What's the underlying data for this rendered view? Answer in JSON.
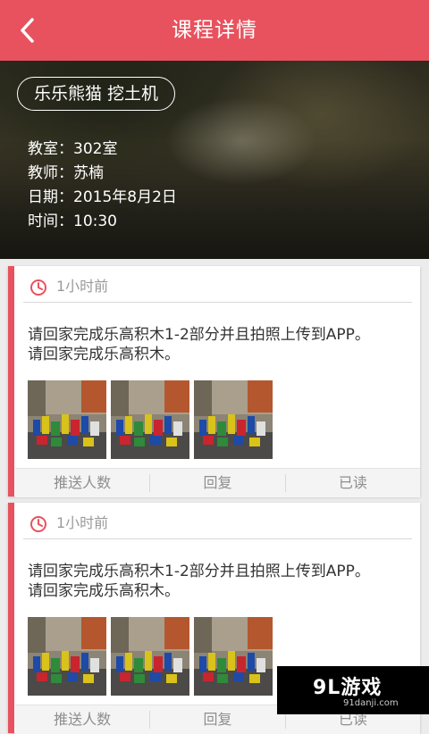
{
  "header": {
    "title": "课程详情"
  },
  "course": {
    "tag": "乐乐熊猫  挖土机",
    "classroom": "教室：302室",
    "teacher": "教师：苏楠",
    "date": "日期：2015年8月2日",
    "time": "时间：10:30"
  },
  "posts": [
    {
      "time": "1小时前",
      "message_line1": "请回家完成乐高积木1-2部分并且拍照上传到APP。",
      "message_line2": "请回家完成乐高积木。",
      "actions": {
        "push_count": "推送人数",
        "reply": "回复",
        "read": "已读"
      }
    },
    {
      "time": "1小时前",
      "message_line1": "请回家完成乐高积木1-2部分并且拍照上传到APP。",
      "message_line2": "请回家完成乐高积木。",
      "actions": {
        "push_count": "推送人数",
        "reply": "回复",
        "read": "已读"
      }
    }
  ],
  "watermark": {
    "main": "9L游戏",
    "sub": "91danji.com"
  },
  "colors": {
    "accent": "#e8525e"
  },
  "icons": [
    "back-arrow-icon",
    "clock-icon"
  ]
}
